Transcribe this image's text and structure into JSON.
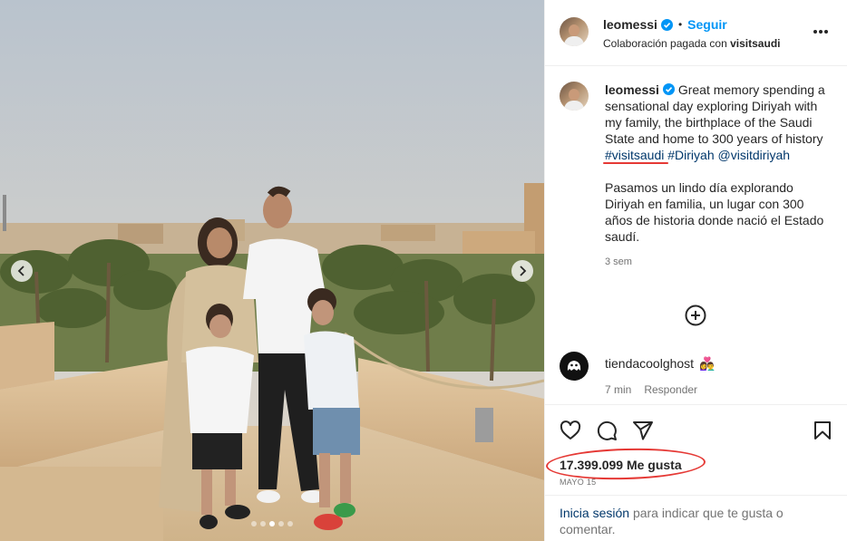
{
  "post": {
    "media": {
      "description_icon": "photo",
      "prev_icon": "chevron-left-icon",
      "next_icon": "chevron-right-icon",
      "slide_count": 5,
      "active_slide": 3
    },
    "header": {
      "username": "leomessi",
      "bullet": "•",
      "follow_label": "Seguir",
      "paid_prefix": "Colaboración pagada con",
      "paid_partner": "visitsaudi"
    },
    "caption": {
      "username": "leomessi",
      "text_en": "Great memory spending a sensational day exploring Diriyah with my family, the birthplace of the Saudi State and home to 300 years of history",
      "hashtags": [
        "#visitsaudi",
        "#Diriyah",
        "@visitdiriyah"
      ],
      "text_es": "Pasamos un lindo día explorando Diriyah en familia, un lugar con 300 años de historia donde nació el Estado saudí.",
      "time": "3 sem"
    },
    "comment": {
      "username": "tiendacoolghost",
      "emoji": "👩‍❤️‍👨",
      "time": "7 min",
      "reply_label": "Responder"
    },
    "actions": {
      "likes": "17.399.099 Me gusta",
      "date": "MAYO 15"
    },
    "login_hint": {
      "link": "Inicia sesión",
      "rest": "para indicar que te gusta o comentar."
    }
  },
  "colors": {
    "accent_blue": "#0095f6",
    "link_dark": "#00376b",
    "annotation_red": "#e53935",
    "muted": "#737373"
  }
}
